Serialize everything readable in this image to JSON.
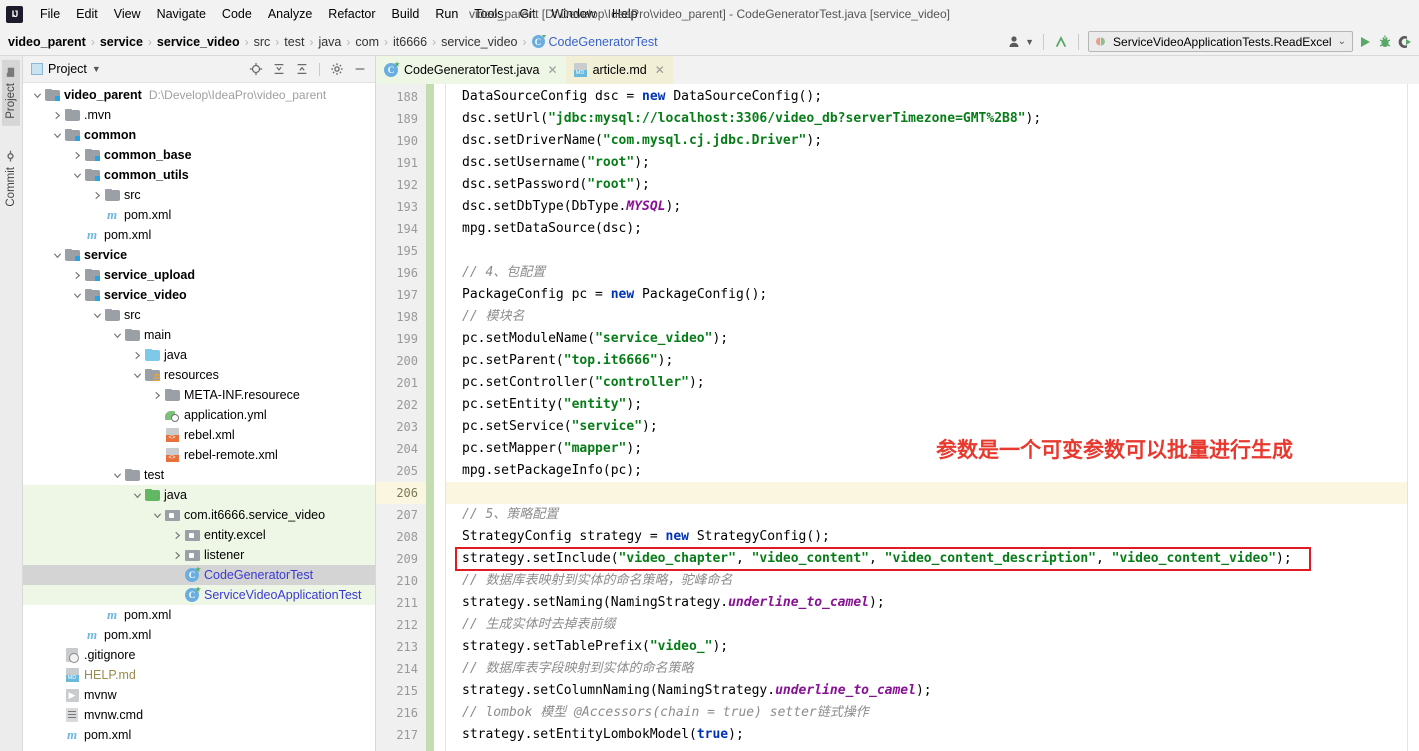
{
  "window": {
    "title": "video_parent [D:\\Develop\\IdeaPro\\video_parent] - CodeGeneratorTest.java [service_video]",
    "logo": "IJ"
  },
  "menubar": {
    "items": [
      {
        "label": "File"
      },
      {
        "label": "Edit"
      },
      {
        "label": "View"
      },
      {
        "label": "Navigate"
      },
      {
        "label": "Code"
      },
      {
        "label": "Analyze"
      },
      {
        "label": "Refactor"
      },
      {
        "label": "Build"
      },
      {
        "label": "Run"
      },
      {
        "label": "Tools"
      },
      {
        "label": "Git"
      },
      {
        "label": "Window"
      },
      {
        "label": "Help"
      }
    ]
  },
  "breadcrumb": {
    "items": [
      {
        "label": "video_parent",
        "style": "bold"
      },
      {
        "label": "service",
        "style": "bold"
      },
      {
        "label": "service_video",
        "style": "bold"
      },
      {
        "label": "src",
        "style": "plain"
      },
      {
        "label": "test",
        "style": "plain"
      },
      {
        "label": "java",
        "style": "plain"
      },
      {
        "label": "com",
        "style": "plain"
      },
      {
        "label": "it6666",
        "style": "plain"
      },
      {
        "label": "service_video",
        "style": "plain"
      },
      {
        "label": "CodeGeneratorTest",
        "style": "link"
      }
    ],
    "separator": "›"
  },
  "toolbar": {
    "run_config": "ServiceVideoApplicationTests.ReadExcel",
    "dropdown_caret": "∨",
    "run_label": "Run",
    "debug_label": "Debug",
    "coverage_label": "Run with Coverage",
    "settings_label": "Settings",
    "accent_green": "#59a869"
  },
  "sidebar_tabs": [
    {
      "label": "Project",
      "active": true
    },
    {
      "label": "Commit",
      "active": false
    }
  ],
  "project_panel": {
    "title": "Project",
    "caret": "▾",
    "actions": [
      "locate-icon",
      "expand-all-icon",
      "collapse-all-icon",
      "gear-icon",
      "minimize-icon"
    ],
    "tree": [
      {
        "indent": 0,
        "arrow": "down",
        "icon": "module-folder",
        "label": "video_parent",
        "bold": true,
        "hint": "D:\\Develop\\IdeaPro\\video_parent"
      },
      {
        "indent": 1,
        "arrow": "right",
        "icon": "folder",
        "label": ".mvn",
        "bold": false
      },
      {
        "indent": 1,
        "arrow": "down",
        "icon": "module-folder",
        "label": "common",
        "bold": true
      },
      {
        "indent": 2,
        "arrow": "right",
        "icon": "module-folder",
        "label": "common_base",
        "bold": true
      },
      {
        "indent": 2,
        "arrow": "down",
        "icon": "module-folder",
        "label": "common_utils",
        "bold": true
      },
      {
        "indent": 3,
        "arrow": "right",
        "icon": "folder",
        "label": "src",
        "bold": false
      },
      {
        "indent": 3,
        "arrow": "none",
        "icon": "maven",
        "label": "pom.xml",
        "bold": false
      },
      {
        "indent": 2,
        "arrow": "none",
        "icon": "maven",
        "label": "pom.xml",
        "bold": false
      },
      {
        "indent": 1,
        "arrow": "down",
        "icon": "module-folder",
        "label": "service",
        "bold": true
      },
      {
        "indent": 2,
        "arrow": "right",
        "icon": "module-folder",
        "label": "service_upload",
        "bold": true
      },
      {
        "indent": 2,
        "arrow": "down",
        "icon": "module-folder",
        "label": "service_video",
        "bold": true
      },
      {
        "indent": 3,
        "arrow": "down",
        "icon": "folder",
        "label": "src",
        "bold": false
      },
      {
        "indent": 4,
        "arrow": "down",
        "icon": "folder",
        "label": "main",
        "bold": false
      },
      {
        "indent": 5,
        "arrow": "right",
        "icon": "folder-blue",
        "label": "java",
        "bold": false
      },
      {
        "indent": 5,
        "arrow": "down",
        "icon": "folder-res",
        "label": "resources",
        "bold": false
      },
      {
        "indent": 6,
        "arrow": "right",
        "icon": "folder",
        "label": "META-INF.resourece",
        "bold": false
      },
      {
        "indent": 6,
        "arrow": "none",
        "icon": "yml",
        "label": "application.yml",
        "bold": false
      },
      {
        "indent": 6,
        "arrow": "none",
        "icon": "xml",
        "label": "rebel.xml",
        "bold": false
      },
      {
        "indent": 6,
        "arrow": "none",
        "icon": "xml",
        "label": "rebel-remote.xml",
        "bold": false
      },
      {
        "indent": 4,
        "arrow": "down",
        "icon": "folder",
        "label": "test",
        "bold": false
      },
      {
        "indent": 5,
        "arrow": "down",
        "icon": "folder-green",
        "label": "java",
        "bold": false,
        "green": true
      },
      {
        "indent": 6,
        "arrow": "down",
        "icon": "package",
        "label": "com.it6666.service_video",
        "bold": false,
        "green": true
      },
      {
        "indent": 7,
        "arrow": "right",
        "icon": "package",
        "label": "entity.excel",
        "bold": false,
        "green": true
      },
      {
        "indent": 7,
        "arrow": "right",
        "icon": "package",
        "label": "listener",
        "bold": false,
        "green": true
      },
      {
        "indent": 7,
        "arrow": "none",
        "icon": "class",
        "label": "CodeGeneratorTest",
        "bold": false,
        "selected": true,
        "blue": true
      },
      {
        "indent": 7,
        "arrow": "none",
        "icon": "class",
        "label": "ServiceVideoApplicationTest",
        "bold": false,
        "green": true,
        "blue": true
      },
      {
        "indent": 3,
        "arrow": "none",
        "icon": "maven",
        "label": "pom.xml",
        "bold": false
      },
      {
        "indent": 2,
        "arrow": "none",
        "icon": "maven",
        "label": "pom.xml",
        "bold": false
      },
      {
        "indent": 1,
        "arrow": "none",
        "icon": "gitignore",
        "label": ".gitignore",
        "bold": false
      },
      {
        "indent": 1,
        "arrow": "none",
        "icon": "md",
        "label": "HELP.md",
        "bold": false,
        "md": true
      },
      {
        "indent": 1,
        "arrow": "none",
        "icon": "shell",
        "label": "mvnw",
        "bold": false
      },
      {
        "indent": 1,
        "arrow": "none",
        "icon": "cmd",
        "label": "mvnw.cmd",
        "bold": false
      },
      {
        "indent": 1,
        "arrow": "none",
        "icon": "maven",
        "label": "pom.xml",
        "bold": false
      }
    ]
  },
  "editor": {
    "tabs": [
      {
        "label": "CodeGeneratorTest.java",
        "icon": "class-icon",
        "active": true,
        "close": "✕"
      },
      {
        "label": "article.md",
        "icon": "md-icon",
        "active": false,
        "close": "✕"
      }
    ],
    "first_line": 188,
    "current_line": 206,
    "highlight_box_line": 209,
    "annotation": "参数是一个可变参数可以批量进行生成",
    "annotation_color": "#e8392f",
    "box_color": "#e01b24",
    "lines": [
      {
        "n": 188,
        "tokens": [
          {
            "t": "DataSourceConfig dsc = ",
            "c": "pn"
          },
          {
            "t": "new ",
            "c": "kw"
          },
          {
            "t": "DataSourceConfig();",
            "c": "pn"
          }
        ]
      },
      {
        "n": 189,
        "tokens": [
          {
            "t": "dsc.setUrl(",
            "c": "pn"
          },
          {
            "t": "\"jdbc:mysql://localhost:3306/video_db?serverTimezone=GMT%2B8\"",
            "c": "str"
          },
          {
            "t": ");",
            "c": "pn"
          }
        ]
      },
      {
        "n": 190,
        "tokens": [
          {
            "t": "dsc.setDriverName(",
            "c": "pn"
          },
          {
            "t": "\"com.mysql.cj.jdbc.Driver\"",
            "c": "str"
          },
          {
            "t": ");",
            "c": "pn"
          }
        ]
      },
      {
        "n": 191,
        "tokens": [
          {
            "t": "dsc.setUsername(",
            "c": "pn"
          },
          {
            "t": "\"root\"",
            "c": "str"
          },
          {
            "t": ");",
            "c": "pn"
          }
        ]
      },
      {
        "n": 192,
        "tokens": [
          {
            "t": "dsc.setPassword(",
            "c": "pn"
          },
          {
            "t": "\"root\"",
            "c": "str"
          },
          {
            "t": ");",
            "c": "pn"
          }
        ]
      },
      {
        "n": 193,
        "tokens": [
          {
            "t": "dsc.setDbType(DbType.",
            "c": "pn"
          },
          {
            "t": "MYSQL",
            "c": "fld"
          },
          {
            "t": ");",
            "c": "pn"
          }
        ]
      },
      {
        "n": 194,
        "tokens": [
          {
            "t": "mpg.setDataSource(dsc);",
            "c": "pn"
          }
        ]
      },
      {
        "n": 195,
        "tokens": []
      },
      {
        "n": 196,
        "tokens": [
          {
            "t": "// 4、包配置",
            "c": "cmt"
          }
        ]
      },
      {
        "n": 197,
        "tokens": [
          {
            "t": "PackageConfig pc = ",
            "c": "pn"
          },
          {
            "t": "new ",
            "c": "kw"
          },
          {
            "t": "PackageConfig();",
            "c": "pn"
          }
        ]
      },
      {
        "n": 198,
        "tokens": [
          {
            "t": "// 模块名",
            "c": "cmt"
          }
        ]
      },
      {
        "n": 199,
        "tokens": [
          {
            "t": "pc.setModuleName(",
            "c": "pn"
          },
          {
            "t": "\"service_video\"",
            "c": "str"
          },
          {
            "t": ");",
            "c": "pn"
          }
        ]
      },
      {
        "n": 200,
        "tokens": [
          {
            "t": "pc.setParent(",
            "c": "pn"
          },
          {
            "t": "\"top.it6666\"",
            "c": "str"
          },
          {
            "t": ");",
            "c": "pn"
          }
        ]
      },
      {
        "n": 201,
        "tokens": [
          {
            "t": "pc.setController(",
            "c": "pn"
          },
          {
            "t": "\"controller\"",
            "c": "str"
          },
          {
            "t": ");",
            "c": "pn"
          }
        ]
      },
      {
        "n": 202,
        "tokens": [
          {
            "t": "pc.setEntity(",
            "c": "pn"
          },
          {
            "t": "\"entity\"",
            "c": "str"
          },
          {
            "t": ");",
            "c": "pn"
          }
        ]
      },
      {
        "n": 203,
        "tokens": [
          {
            "t": "pc.setService(",
            "c": "pn"
          },
          {
            "t": "\"service\"",
            "c": "str"
          },
          {
            "t": ");",
            "c": "pn"
          }
        ]
      },
      {
        "n": 204,
        "tokens": [
          {
            "t": "pc.setMapper(",
            "c": "pn"
          },
          {
            "t": "\"mapper\"",
            "c": "str"
          },
          {
            "t": ");",
            "c": "pn"
          }
        ]
      },
      {
        "n": 205,
        "tokens": [
          {
            "t": "mpg.setPackageInfo(pc);",
            "c": "pn"
          }
        ]
      },
      {
        "n": 206,
        "tokens": []
      },
      {
        "n": 207,
        "tokens": [
          {
            "t": "// 5、策略配置",
            "c": "cmt"
          }
        ]
      },
      {
        "n": 208,
        "tokens": [
          {
            "t": "StrategyConfig strategy = ",
            "c": "pn"
          },
          {
            "t": "new ",
            "c": "kw"
          },
          {
            "t": "StrategyConfig();",
            "c": "pn"
          }
        ]
      },
      {
        "n": 209,
        "tokens": [
          {
            "t": "strategy.setInclude(",
            "c": "pn"
          },
          {
            "t": "\"video_chapter\"",
            "c": "str"
          },
          {
            "t": ", ",
            "c": "pn"
          },
          {
            "t": "\"video_content\"",
            "c": "str"
          },
          {
            "t": ", ",
            "c": "pn"
          },
          {
            "t": "\"video_content_description\"",
            "c": "str"
          },
          {
            "t": ", ",
            "c": "pn"
          },
          {
            "t": "\"video_content_video\"",
            "c": "str"
          },
          {
            "t": ");",
            "c": "pn"
          }
        ]
      },
      {
        "n": 210,
        "tokens": [
          {
            "t": "// 数据库表映射到实体的命名策略，驼峰命名",
            "c": "cmt"
          }
        ]
      },
      {
        "n": 211,
        "tokens": [
          {
            "t": "strategy.setNaming(NamingStrategy.",
            "c": "pn"
          },
          {
            "t": "underline_to_camel",
            "c": "fld"
          },
          {
            "t": ");",
            "c": "pn"
          }
        ]
      },
      {
        "n": 212,
        "tokens": [
          {
            "t": "// 生成实体时去掉表前缀",
            "c": "cmt"
          }
        ]
      },
      {
        "n": 213,
        "tokens": [
          {
            "t": "strategy.setTablePrefix(",
            "c": "pn"
          },
          {
            "t": "\"video_\"",
            "c": "str"
          },
          {
            "t": ");",
            "c": "pn"
          }
        ]
      },
      {
        "n": 214,
        "tokens": [
          {
            "t": "// 数据库表字段映射到实体的命名策略",
            "c": "cmt"
          }
        ]
      },
      {
        "n": 215,
        "tokens": [
          {
            "t": "strategy.setColumnNaming(NamingStrategy.",
            "c": "pn"
          },
          {
            "t": "underline_to_camel",
            "c": "fld"
          },
          {
            "t": ");",
            "c": "pn"
          }
        ]
      },
      {
        "n": 216,
        "tokens": [
          {
            "t": "// lombok 模型 @Accessors(chain = true) setter链式操作",
            "c": "cmt"
          }
        ]
      },
      {
        "n": 217,
        "tokens": [
          {
            "t": "strategy.setEntityLombokModel(",
            "c": "pn"
          },
          {
            "t": "true",
            "c": "kw"
          },
          {
            "t": ");",
            "c": "pn"
          }
        ]
      }
    ]
  }
}
